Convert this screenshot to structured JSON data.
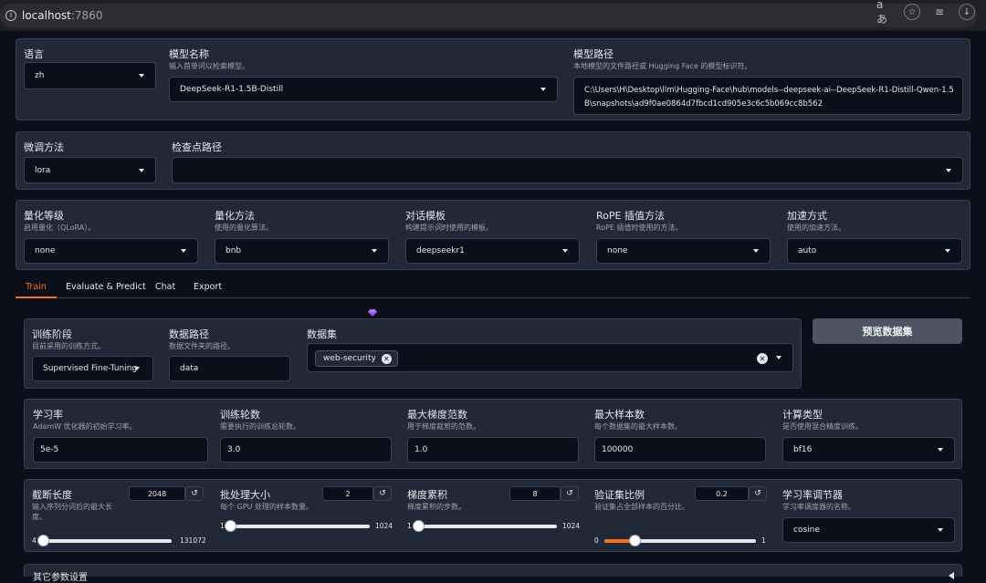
{
  "browser": {
    "url_host": "localhost",
    "url_port": ":7860",
    "translate_icon_text": "aあ"
  },
  "row1": {
    "language": {
      "label": "语言",
      "value": "zh"
    },
    "model_name": {
      "label": "模型名称",
      "info": "输入首单词以检索模型。",
      "value": "DeepSeek-R1-1.5B-Distill"
    },
    "model_path": {
      "label": "模型路径",
      "info": "本地模型的文件路径或 Hugging Face 的模型标识符。",
      "value": "C:\\Users\\H\\Desktop\\llm\\Hugging-Face\\hub\\models--deepseek-ai--DeepSeek-R1-Distill-Qwen-1.5B\\snapshots\\ad9f0ae0864d7fbcd1cd905e3c6c5b069cc8b562"
    }
  },
  "row2": {
    "finetune": {
      "label": "微调方法",
      "value": "lora"
    },
    "checkpoint": {
      "label": "检查点路径",
      "value": ""
    }
  },
  "row3": {
    "quant_bit": {
      "label": "量化等级",
      "info": "启用量化（QLoRA）。",
      "value": "none"
    },
    "quant_method": {
      "label": "量化方法",
      "info": "使用的量化算法。",
      "value": "bnb"
    },
    "template": {
      "label": "对话模板",
      "info": "构建提示词时使用的模板。",
      "value": "deepseekr1"
    },
    "rope": {
      "label": "RoPE 插值方法",
      "info": "RoPE 插值时使用的方法。",
      "value": "none"
    },
    "booster": {
      "label": "加速方式",
      "info": "使用的加速方法。",
      "value": "auto"
    }
  },
  "tabs": [
    "Train",
    "Evaluate & Predict",
    "Chat",
    "Export"
  ],
  "train_top": {
    "stage": {
      "label": "训练阶段",
      "info": "目前采用的训练方式。",
      "value": "Supervised Fine-Tuning"
    },
    "dataset_dir": {
      "label": "数据路径",
      "info": "数据文件夹的路径。",
      "value": "data"
    },
    "dataset": {
      "label": "数据集",
      "chip": "web-security"
    },
    "preview_button": "预览数据集"
  },
  "train_params": {
    "lr": {
      "label": "学习率",
      "info": "AdamW 优化器的初始学习率。",
      "value": "5e-5"
    },
    "epochs": {
      "label": "训练轮数",
      "info": "需要执行的训练总轮数。",
      "value": "3.0"
    },
    "max_grad": {
      "label": "最大梯度范数",
      "info": "用于梯度裁剪的范数。",
      "value": "1.0"
    },
    "max_samples": {
      "label": "最大样本数",
      "info": "每个数据集的最大样本数。",
      "value": "100000"
    },
    "compute_type": {
      "label": "计算类型",
      "info": "是否使用混合精度训练。",
      "value": "bf16"
    }
  },
  "sliders": {
    "cutoff": {
      "label": "截断长度",
      "info": "输入序列分词后的最大长度。",
      "value": "2048",
      "min": "4",
      "max": "131072",
      "fraction": 0.016
    },
    "batch": {
      "label": "批处理大小",
      "info": "每个 GPU 处理的样本数量。",
      "value": "2",
      "min": "1",
      "max": "1024",
      "fraction": 0.001
    },
    "grad_acc": {
      "label": "梯度累积",
      "info": "梯度累积的步数。",
      "value": "8",
      "min": "1",
      "max": "1024",
      "fraction": 0.007
    },
    "val_size": {
      "label": "验证集比例",
      "info": "验证集占全部样本的百分比。",
      "value": "0.2",
      "min": "0",
      "max": "1",
      "fraction": 0.2
    },
    "scheduler": {
      "label": "学习率调节器",
      "info": "学习率调度器的名称。",
      "value": "cosine"
    }
  },
  "other_settings": "其它参数设置",
  "reset_glyph": "↺",
  "remove_glyph": "✕"
}
